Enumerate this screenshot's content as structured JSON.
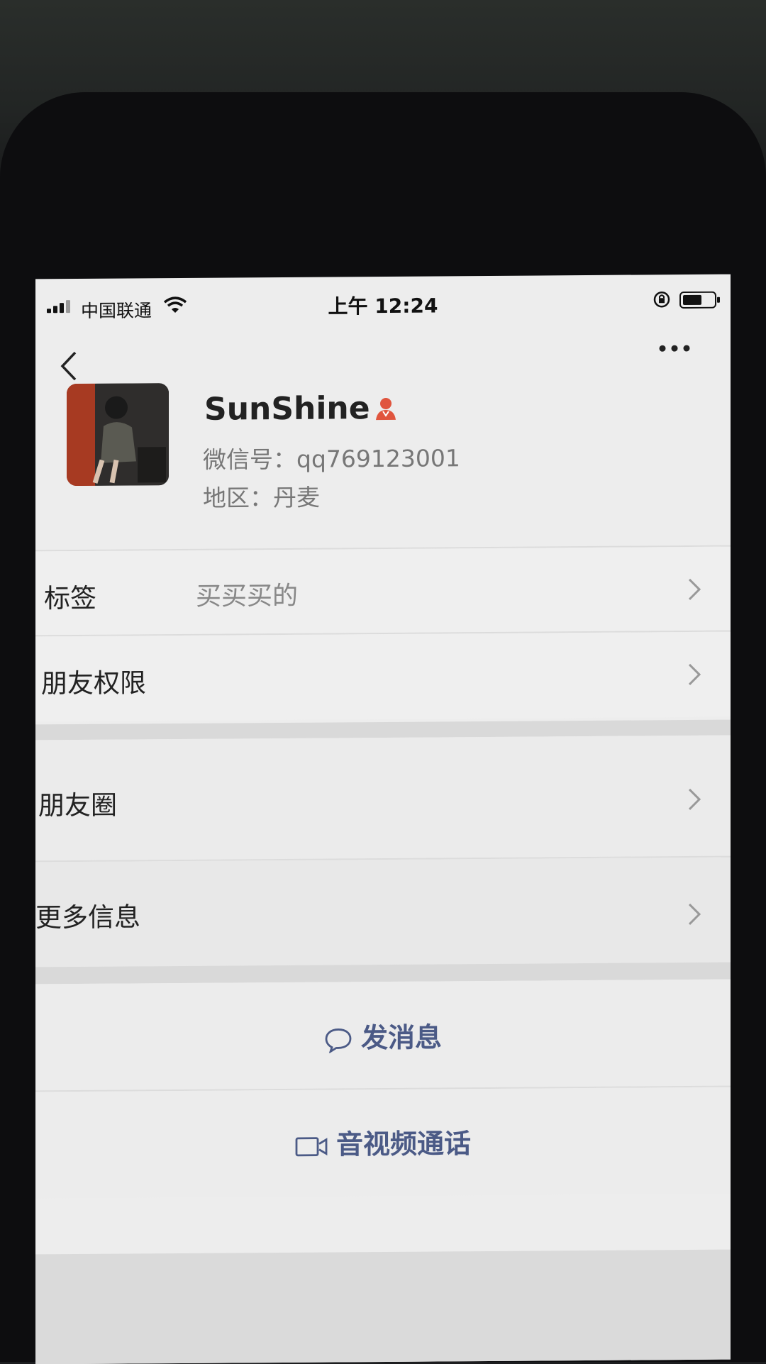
{
  "status_bar": {
    "carrier": "中国联通",
    "time": "上午 12:24"
  },
  "profile": {
    "nickname": "SunShine",
    "wechat_id": "微信号：qq769123001",
    "region": "地区：丹麦",
    "gender_icon": "female-user-icon"
  },
  "rows": {
    "tags": {
      "label": "标签",
      "value": "买买买的"
    },
    "permissions": {
      "label": "朋友权限"
    },
    "moments": {
      "label": "朋友圈"
    },
    "more_info": {
      "label": "更多信息"
    }
  },
  "actions": {
    "message": "发消息",
    "call": "音视频通话"
  },
  "colors": {
    "accent": "#4b5a86",
    "gender": "#e0553e"
  }
}
